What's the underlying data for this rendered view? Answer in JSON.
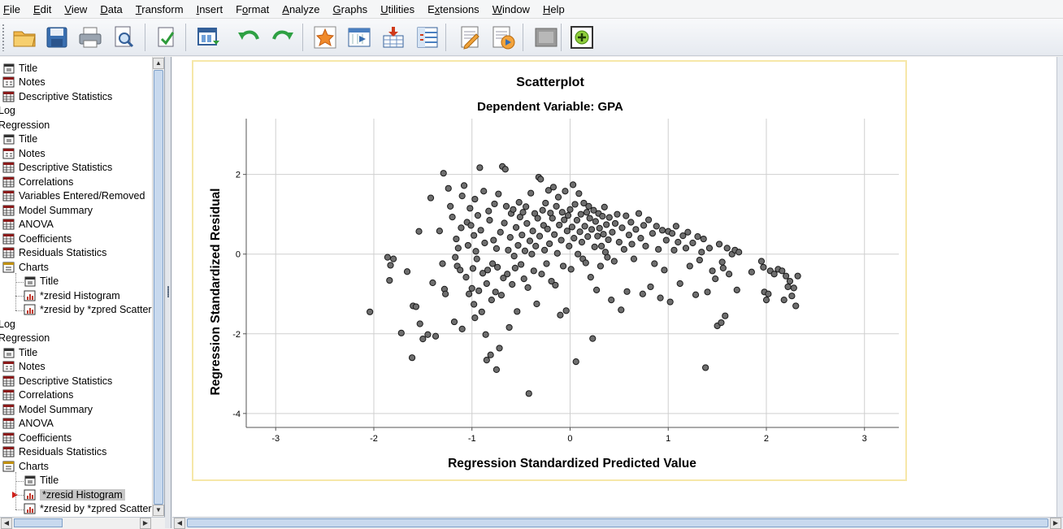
{
  "menu": [
    {
      "label": "File",
      "accel": "F",
      "rest": "ile"
    },
    {
      "label": "Edit",
      "accel": "E",
      "rest": "dit"
    },
    {
      "label": "View",
      "accel": "V",
      "rest": "iew"
    },
    {
      "label": "Data",
      "accel": "D",
      "rest": "ata"
    },
    {
      "label": "Transform",
      "accel": "T",
      "rest": "ransform"
    },
    {
      "label": "Insert",
      "accel": "I",
      "rest": "nsert"
    },
    {
      "label": "Format",
      "pre": "F",
      "accel": "o",
      "rest": "rmat"
    },
    {
      "label": "Analyze",
      "accel": "A",
      "rest": "nalyze"
    },
    {
      "label": "Graphs",
      "accel": "G",
      "rest": "raphs"
    },
    {
      "label": "Utilities",
      "accel": "U",
      "rest": "tilities"
    },
    {
      "label": "Extensions",
      "pre": "E",
      "accel": "x",
      "rest": "tensions"
    },
    {
      "label": "Window",
      "accel": "W",
      "rest": "indow"
    },
    {
      "label": "Help",
      "accel": "H",
      "rest": "elp"
    }
  ],
  "toolbar": [
    {
      "name": "open-folder-icon"
    },
    {
      "name": "save-icon"
    },
    {
      "name": "print-icon"
    },
    {
      "name": "print-preview-icon"
    },
    {
      "name": "export-icon"
    },
    {
      "name": "recall-dialog-icon"
    },
    {
      "name": "undo-icon"
    },
    {
      "name": "redo-icon"
    },
    {
      "name": "goto-case-icon"
    },
    {
      "name": "goto-variable-icon"
    },
    {
      "name": "insert-case-icon"
    },
    {
      "name": "variables-icon"
    },
    {
      "name": "designate-window-icon"
    },
    {
      "name": "run-script-icon"
    },
    {
      "name": "disabled-icon"
    },
    {
      "name": "add-item-icon"
    }
  ],
  "tree": [
    {
      "label": "Title",
      "icon": "title",
      "level": 0
    },
    {
      "label": "Notes",
      "icon": "notes",
      "level": 0
    },
    {
      "label": "Descriptive Statistics",
      "icon": "table",
      "level": 0
    },
    {
      "label": "Log",
      "icon": "none",
      "level": -1
    },
    {
      "label": "Regression",
      "icon": "none",
      "level": -1
    },
    {
      "label": "Title",
      "icon": "title",
      "level": 0
    },
    {
      "label": "Notes",
      "icon": "notes",
      "level": 0
    },
    {
      "label": "Descriptive Statistics",
      "icon": "table",
      "level": 0
    },
    {
      "label": "Correlations",
      "icon": "table",
      "level": 0
    },
    {
      "label": "Variables Entered/Removed",
      "icon": "table",
      "level": 0
    },
    {
      "label": "Model Summary",
      "icon": "table",
      "level": 0
    },
    {
      "label": "ANOVA",
      "icon": "table",
      "level": 0
    },
    {
      "label": "Coefficients",
      "icon": "table",
      "level": 0
    },
    {
      "label": "Residuals Statistics",
      "icon": "table",
      "level": 0
    },
    {
      "label": "Charts",
      "icon": "folder",
      "level": 0
    },
    {
      "label": "Title",
      "icon": "title",
      "level": 1
    },
    {
      "label": "*zresid Histogram",
      "icon": "chart",
      "level": 1
    },
    {
      "label": "*zresid by *zpred Scatterplot",
      "icon": "chart",
      "level": 1
    },
    {
      "label": "Log",
      "icon": "none",
      "level": -1
    },
    {
      "label": "Regression",
      "icon": "none",
      "level": -1
    },
    {
      "label": "Title",
      "icon": "title",
      "level": 0
    },
    {
      "label": "Notes",
      "icon": "notes",
      "level": 0
    },
    {
      "label": "Descriptive Statistics",
      "icon": "table",
      "level": 0
    },
    {
      "label": "Correlations",
      "icon": "table",
      "level": 0
    },
    {
      "label": "Model Summary",
      "icon": "table",
      "level": 0
    },
    {
      "label": "ANOVA",
      "icon": "table",
      "level": 0
    },
    {
      "label": "Coefficients",
      "icon": "table",
      "level": 0
    },
    {
      "label": "Residuals Statistics",
      "icon": "table",
      "level": 0
    },
    {
      "label": "Charts",
      "icon": "folder",
      "level": 0
    },
    {
      "label": "Title",
      "icon": "title",
      "level": 1
    },
    {
      "label": "*zresid Histogram",
      "icon": "chart",
      "level": 1,
      "selected": true,
      "current": true
    },
    {
      "label": "*zresid by *zpred Scatterplot",
      "icon": "chart",
      "level": 1
    }
  ],
  "chart_data": {
    "type": "scatter",
    "title": "Scatterplot",
    "subtitle": "Dependent Variable: GPA",
    "xlabel": "Regression Standardized Predicted Value",
    "ylabel": "Regression Standardized Residual",
    "xlim": [
      -3.3,
      3.35
    ],
    "ylim": [
      -4.35,
      3.4
    ],
    "xticks": [
      -3,
      -2,
      -1,
      0,
      1,
      2,
      3
    ],
    "yticks": [
      -4,
      -2,
      0,
      2
    ],
    "grid": true,
    "point_color": "#6e6e6e",
    "points": [
      [
        -2.04,
        -1.45
      ],
      [
        -1.86,
        -0.08
      ],
      [
        -1.84,
        -0.66
      ],
      [
        -1.83,
        -0.28
      ],
      [
        -1.8,
        -0.12
      ],
      [
        -1.72,
        -1.98
      ],
      [
        -1.66,
        -0.44
      ],
      [
        -1.61,
        -2.6
      ],
      [
        -1.6,
        -1.3
      ],
      [
        -1.57,
        -1.32
      ],
      [
        -1.54,
        0.57
      ],
      [
        -1.53,
        -1.75
      ],
      [
        -1.5,
        -2.13
      ],
      [
        -1.45,
        -2.02
      ],
      [
        -1.42,
        1.41
      ],
      [
        -1.4,
        -0.72
      ],
      [
        -1.37,
        -2.06
      ],
      [
        -1.33,
        0.58
      ],
      [
        -1.3,
        -0.24
      ],
      [
        -1.28,
        -0.88
      ],
      [
        -1.27,
        -1.0
      ],
      [
        -1.29,
        2.03
      ],
      [
        -1.24,
        1.65
      ],
      [
        -1.22,
        1.2
      ],
      [
        -1.2,
        0.93
      ],
      [
        -1.18,
        -1.7
      ],
      [
        -1.17,
        -0.08
      ],
      [
        -1.16,
        0.38
      ],
      [
        -1.15,
        -0.3
      ],
      [
        -1.14,
        0.15
      ],
      [
        -1.12,
        -0.4
      ],
      [
        -1.11,
        0.66
      ],
      [
        -1.1,
        1.46
      ],
      [
        -1.1,
        -1.88
      ],
      [
        -1.08,
        1.72
      ],
      [
        -1.06,
        -0.58
      ],
      [
        -1.05,
        0.8
      ],
      [
        -1.04,
        0.22
      ],
      [
        -1.03,
        -1.0
      ],
      [
        -1.02,
        1.15
      ],
      [
        -1.01,
        0.72
      ],
      [
        -1.0,
        -0.86
      ],
      [
        -0.99,
        -0.36
      ],
      [
        -0.98,
        -1.26
      ],
      [
        -0.98,
        0.47
      ],
      [
        -0.97,
        1.38
      ],
      [
        -0.97,
        -1.6
      ],
      [
        -0.96,
        0.07
      ],
      [
        -0.95,
        -0.12
      ],
      [
        -0.94,
        0.97
      ],
      [
        -0.93,
        -0.92
      ],
      [
        -0.92,
        2.17
      ],
      [
        -0.91,
        0.6
      ],
      [
        -0.9,
        -1.45
      ],
      [
        -0.89,
        -0.48
      ],
      [
        -0.88,
        1.58
      ],
      [
        -0.87,
        0.28
      ],
      [
        -0.86,
        -2.02
      ],
      [
        -0.85,
        -2.66
      ],
      [
        -0.85,
        -0.74
      ],
      [
        -0.84,
        -0.4
      ],
      [
        -0.83,
        1.08
      ],
      [
        -0.82,
        0.85
      ],
      [
        -0.81,
        -2.53
      ],
      [
        -0.8,
        -1.15
      ],
      [
        -0.79,
        -0.24
      ],
      [
        -0.78,
        0.35
      ],
      [
        -0.77,
        1.26
      ],
      [
        -0.76,
        -0.95
      ],
      [
        -0.75,
        -2.9
      ],
      [
        -0.75,
        0.14
      ],
      [
        -0.74,
        -0.33
      ],
      [
        -0.73,
        1.51
      ],
      [
        -0.72,
        -2.36
      ],
      [
        -0.71,
        0.55
      ],
      [
        -0.7,
        -1.03
      ],
      [
        -0.69,
        2.2
      ],
      [
        -0.68,
        -0.6
      ],
      [
        -0.67,
        0.78
      ],
      [
        -0.66,
        2.13
      ],
      [
        -0.65,
        1.2
      ],
      [
        -0.64,
        -0.5
      ],
      [
        -0.63,
        0.1
      ],
      [
        -0.62,
        -1.84
      ],
      [
        -0.61,
        0.42
      ],
      [
        -0.6,
        1.02
      ],
      [
        -0.59,
        -0.76
      ],
      [
        -0.58,
        1.12
      ],
      [
        -0.57,
        -0.05
      ],
      [
        -0.56,
        -0.35
      ],
      [
        -0.55,
        0.67
      ],
      [
        -0.54,
        -1.44
      ],
      [
        -0.53,
        0.22
      ],
      [
        -0.52,
        1.3
      ],
      [
        -0.51,
        0.93
      ],
      [
        -0.5,
        -0.26
      ],
      [
        -0.49,
        0.48
      ],
      [
        -0.48,
        1.05
      ],
      [
        -0.47,
        -0.62
      ],
      [
        -0.46,
        0.08
      ],
      [
        -0.45,
        1.19
      ],
      [
        -0.44,
        0.77
      ],
      [
        -0.43,
        -0.84
      ],
      [
        -0.42,
        -3.5
      ],
      [
        -0.41,
        0.33
      ],
      [
        -0.4,
        1.53
      ],
      [
        -0.39,
        0.0
      ],
      [
        -0.38,
        0.58
      ],
      [
        -0.37,
        -0.42
      ],
      [
        -0.36,
        1.02
      ],
      [
        -0.35,
        0.2
      ],
      [
        -0.34,
        -1.25
      ],
      [
        -0.33,
        0.9
      ],
      [
        -0.32,
        1.93
      ],
      [
        -0.31,
        0.45
      ],
      [
        -0.3,
        1.88
      ],
      [
        -0.29,
        -0.5
      ],
      [
        -0.28,
        1.1
      ],
      [
        -0.27,
        0.72
      ],
      [
        -0.26,
        0.1
      ],
      [
        -0.25,
        1.28
      ],
      [
        -0.24,
        -0.24
      ],
      [
        -0.23,
        0.63
      ],
      [
        -0.22,
        1.6
      ],
      [
        -0.21,
        0.26
      ],
      [
        -0.2,
        1.03
      ],
      [
        -0.19,
        -0.68
      ],
      [
        -0.18,
        0.9
      ],
      [
        -0.17,
        1.68
      ],
      [
        -0.16,
        0.49
      ],
      [
        -0.15,
        -0.78
      ],
      [
        -0.14,
        1.2
      ],
      [
        -0.13,
        0.02
      ],
      [
        -0.12,
        1.43
      ],
      [
        -0.11,
        0.73
      ],
      [
        -0.1,
        -1.53
      ],
      [
        -0.09,
        0.35
      ],
      [
        -0.08,
        1.05
      ],
      [
        -0.07,
        -0.3
      ],
      [
        -0.06,
        0.86
      ],
      [
        -0.05,
        1.58
      ],
      [
        -0.04,
        -1.42
      ],
      [
        -0.03,
        0.58
      ],
      [
        -0.02,
        0.97
      ],
      [
        -0.01,
        0.2
      ],
      [
        0.0,
        1.12
      ],
      [
        0.01,
        -0.38
      ],
      [
        0.02,
        0.68
      ],
      [
        0.03,
        1.74
      ],
      [
        0.04,
        0.4
      ],
      [
        0.05,
        1.25
      ],
      [
        0.06,
        -2.7
      ],
      [
        0.07,
        0.85
      ],
      [
        0.08,
        0.0
      ],
      [
        0.09,
        1.52
      ],
      [
        0.1,
        0.56
      ],
      [
        0.11,
        1.0
      ],
      [
        0.12,
        0.3
      ],
      [
        0.13,
        -0.12
      ],
      [
        0.14,
        1.28
      ],
      [
        0.15,
        0.7
      ],
      [
        0.16,
        -0.22
      ],
      [
        0.17,
        1.05
      ],
      [
        0.18,
        0.44
      ],
      [
        0.19,
        1.2
      ],
      [
        0.2,
        0.9
      ],
      [
        0.21,
        -0.58
      ],
      [
        0.22,
        0.62
      ],
      [
        0.23,
        -2.12
      ],
      [
        0.24,
        1.1
      ],
      [
        0.25,
        0.18
      ],
      [
        0.26,
        0.82
      ],
      [
        0.27,
        -0.9
      ],
      [
        0.28,
        0.45
      ],
      [
        0.29,
        1.02
      ],
      [
        0.3,
        0.65
      ],
      [
        0.31,
        -0.3
      ],
      [
        0.32,
        0.2
      ],
      [
        0.33,
        0.95
      ],
      [
        0.34,
        0.5
      ],
      [
        0.35,
        1.18
      ],
      [
        0.36,
        0.05
      ],
      [
        0.37,
        0.74
      ],
      [
        0.38,
        -0.08
      ],
      [
        0.39,
        0.36
      ],
      [
        0.4,
        0.92
      ],
      [
        0.42,
        -1.15
      ],
      [
        0.43,
        0.55
      ],
      [
        0.45,
        -0.18
      ],
      [
        0.46,
        0.77
      ],
      [
        0.48,
        1.0
      ],
      [
        0.5,
        0.3
      ],
      [
        0.52,
        -1.4
      ],
      [
        0.53,
        0.66
      ],
      [
        0.55,
        0.12
      ],
      [
        0.57,
        0.96
      ],
      [
        0.58,
        -0.94
      ],
      [
        0.6,
        0.48
      ],
      [
        0.62,
        0.8
      ],
      [
        0.63,
        0.25
      ],
      [
        0.65,
        -0.12
      ],
      [
        0.67,
        0.62
      ],
      [
        0.7,
        1.02
      ],
      [
        0.72,
        0.4
      ],
      [
        0.74,
        -1.0
      ],
      [
        0.75,
        0.72
      ],
      [
        0.77,
        0.2
      ],
      [
        0.8,
        0.86
      ],
      [
        0.82,
        -0.82
      ],
      [
        0.84,
        0.52
      ],
      [
        0.86,
        -0.24
      ],
      [
        0.88,
        0.7
      ],
      [
        0.9,
        0.12
      ],
      [
        0.92,
        -1.1
      ],
      [
        0.94,
        0.6
      ],
      [
        0.96,
        -0.4
      ],
      [
        0.98,
        0.35
      ],
      [
        1.0,
        0.57
      ],
      [
        1.02,
        -1.2
      ],
      [
        1.04,
        0.52
      ],
      [
        1.06,
        0.1
      ],
      [
        1.08,
        0.7
      ],
      [
        1.1,
        0.3
      ],
      [
        1.12,
        -0.74
      ],
      [
        1.15,
        0.46
      ],
      [
        1.18,
        0.15
      ],
      [
        1.2,
        0.55
      ],
      [
        1.22,
        -0.3
      ],
      [
        1.25,
        0.28
      ],
      [
        1.28,
        -1.02
      ],
      [
        1.3,
        0.44
      ],
      [
        1.32,
        -0.15
      ],
      [
        1.34,
        0.05
      ],
      [
        1.36,
        0.38
      ],
      [
        1.38,
        -2.85
      ],
      [
        1.4,
        -0.95
      ],
      [
        1.42,
        0.15
      ],
      [
        1.45,
        -0.42
      ],
      [
        1.48,
        -0.62
      ],
      [
        1.5,
        -1.8
      ],
      [
        1.52,
        0.25
      ],
      [
        1.54,
        -1.72
      ],
      [
        1.55,
        -0.2
      ],
      [
        1.56,
        -0.35
      ],
      [
        1.58,
        -1.55
      ],
      [
        1.6,
        0.15
      ],
      [
        1.62,
        -0.5
      ],
      [
        1.65,
        0.0
      ],
      [
        1.68,
        0.1
      ],
      [
        1.7,
        -0.9
      ],
      [
        1.72,
        0.05
      ],
      [
        1.85,
        -0.45
      ],
      [
        1.95,
        -0.18
      ],
      [
        1.97,
        -0.33
      ],
      [
        1.98,
        -0.95
      ],
      [
        2.0,
        -1.15
      ],
      [
        2.02,
        -1.0
      ],
      [
        2.04,
        -0.42
      ],
      [
        2.08,
        -0.5
      ],
      [
        2.12,
        -0.38
      ],
      [
        2.16,
        -0.42
      ],
      [
        2.18,
        -1.15
      ],
      [
        2.2,
        -0.55
      ],
      [
        2.22,
        -0.82
      ],
      [
        2.24,
        -0.68
      ],
      [
        2.26,
        -1.05
      ],
      [
        2.28,
        -0.85
      ],
      [
        2.3,
        -1.3
      ],
      [
        2.32,
        -0.55
      ]
    ]
  }
}
